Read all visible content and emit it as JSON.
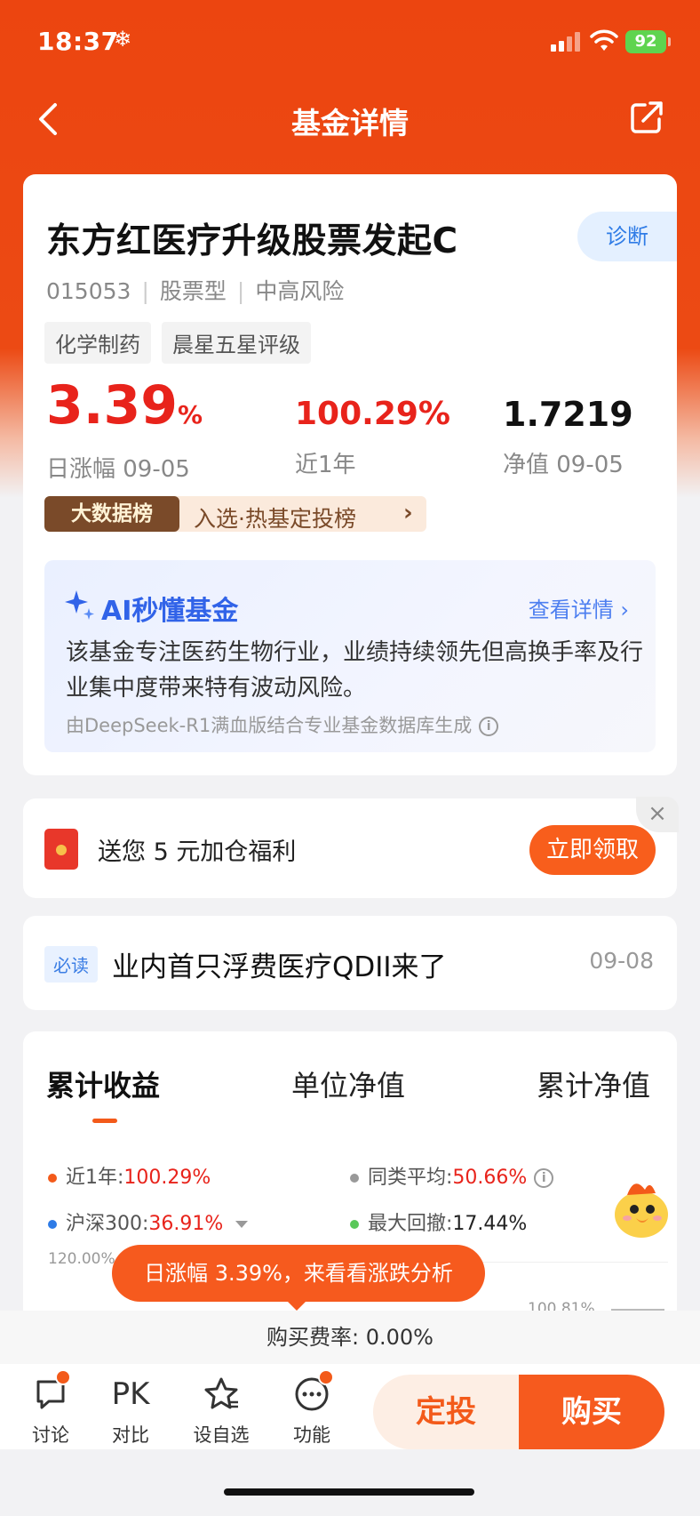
{
  "status_bar": {
    "time": "18:37",
    "snow": "❄",
    "battery": "92"
  },
  "nav": {
    "title": "基金详情"
  },
  "fund": {
    "name": "东方红医疗升级股票发起C",
    "code": "015053",
    "type": "股票型",
    "risk": "中高风险",
    "diagnose": "诊断",
    "tags": [
      "化学制药",
      "晨星五星评级"
    ],
    "daily_change": "3.39",
    "daily_change_pct": "%",
    "daily_label": "日涨幅 09-05",
    "yearly_change": "100.29%",
    "yearly_label": "近1年",
    "nav_value": "1.7219",
    "nav_label": "净值 09-05"
  },
  "bigdata": {
    "badge": "大数据榜",
    "text": "入选·热基定投榜",
    "chevron": "›"
  },
  "ai": {
    "title": "AI秒懂基金",
    "more": "查看详情 ›",
    "desc": "该基金专注医药生物行业，业绩持续领先但高换手率及行业集中度带来特有波动风险。",
    "footer": "由DeepSeek-R1满血版结合专业基金数据库生成"
  },
  "gift": {
    "text": "送您 5 元加仓福利",
    "button": "立即领取",
    "close": "×"
  },
  "news": {
    "tag": "必读",
    "title": "业内首只浮费医疗QDII来了",
    "date": "09-08"
  },
  "chart_tabs": [
    "累计收益",
    "单位净值",
    "累计净值"
  ],
  "legend": {
    "year_label": "近1年:",
    "year_value": "100.29%",
    "peer_label": "同类平均:",
    "peer_value": "50.66%",
    "hs300_label": "沪深300:",
    "hs300_value": "36.91%",
    "drawdown_label": "最大回撤:",
    "drawdown_value": "17.44%"
  },
  "chart": {
    "y_top_label": "120.00%",
    "right_label": "100.81%"
  },
  "tooltip": "日涨幅 3.39%，来看看涨跌分析",
  "fee": "购买费率: 0.00%",
  "bottom_nav": [
    {
      "label": "讨论",
      "icon": "chat-icon"
    },
    {
      "label": "对比",
      "icon_text": "PK"
    },
    {
      "label": "设自选",
      "icon": "star-icon"
    },
    {
      "label": "功能",
      "icon": "more-icon"
    }
  ],
  "actions": {
    "sip": "定投",
    "buy": "购买"
  },
  "colors": {
    "brand": "#ec4510",
    "up_red": "#e8231b",
    "ai_blue": "#3163e8"
  }
}
